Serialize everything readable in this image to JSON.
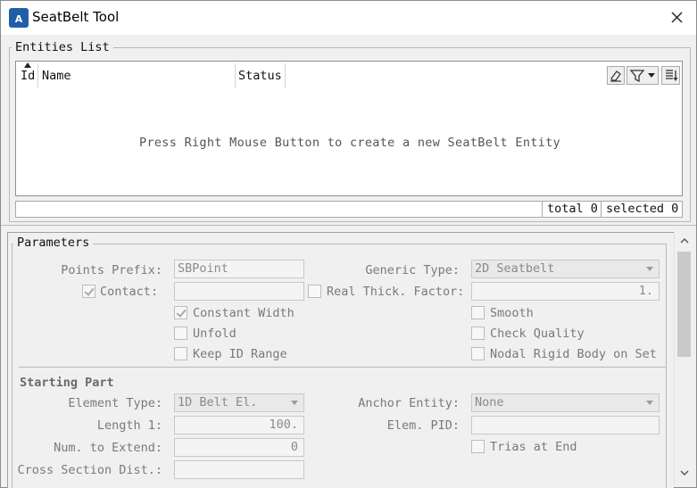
{
  "window": {
    "title": "SeatBelt Tool"
  },
  "icons": {
    "app": "app-logo-icon",
    "close": "close-icon",
    "sort": "sort-ascending-icon",
    "eraser": "eraser-icon",
    "filter": "filter-icon",
    "dropdown": "chevron-down-icon",
    "columns": "column-settings-icon",
    "scroll_up": "scroll-up-icon",
    "scroll_down": "scroll-down-icon"
  },
  "entities": {
    "legend": "Entities List",
    "columns": [
      "Id",
      "Name",
      "Status"
    ],
    "hint": "Press Right Mouse Button to create a new SeatBelt Entity",
    "total": "total 0",
    "selected": "selected 0"
  },
  "params": {
    "legend": "Parameters",
    "points_prefix_label": "Points Prefix:",
    "points_prefix_value": "SBPoint",
    "generic_type_label": "Generic Type:",
    "generic_type_value": "2D Seatbelt",
    "contact_label": "Contact:",
    "contact_checked": true,
    "contact_value": "",
    "real_thick_label": "Real Thick. Factor:",
    "real_thick_checked": false,
    "real_thick_value": "1.",
    "constant_width_label": "Constant Width",
    "constant_width_checked": true,
    "smooth_label": "Smooth",
    "smooth_checked": false,
    "unfold_label": "Unfold",
    "unfold_checked": false,
    "check_quality_label": "Check Quality",
    "check_quality_checked": false,
    "keep_id_label": "Keep ID Range",
    "keep_id_checked": false,
    "nodal_rigid_label": "Nodal Rigid Body on Set",
    "nodal_rigid_checked": false
  },
  "starting_part": {
    "title": "Starting Part",
    "element_type_label": "Element Type:",
    "element_type_value": "1D Belt El.",
    "anchor_entity_label": "Anchor Entity:",
    "anchor_entity_value": "None",
    "length_label": "Length 1:",
    "length_value": "100.",
    "elem_pid_label": "Elem. PID:",
    "elem_pid_value": "",
    "num_extend_label": "Num. to Extend:",
    "num_extend_value": "0",
    "trias_label": "Trias at End",
    "trias_checked": false,
    "cross_section_label": "Cross Section Dist.:",
    "cross_section_value": ""
  },
  "colors": {
    "accent": "#1f5fa8",
    "window_bg": "#f0f0f0",
    "border": "#b9b9b9"
  }
}
